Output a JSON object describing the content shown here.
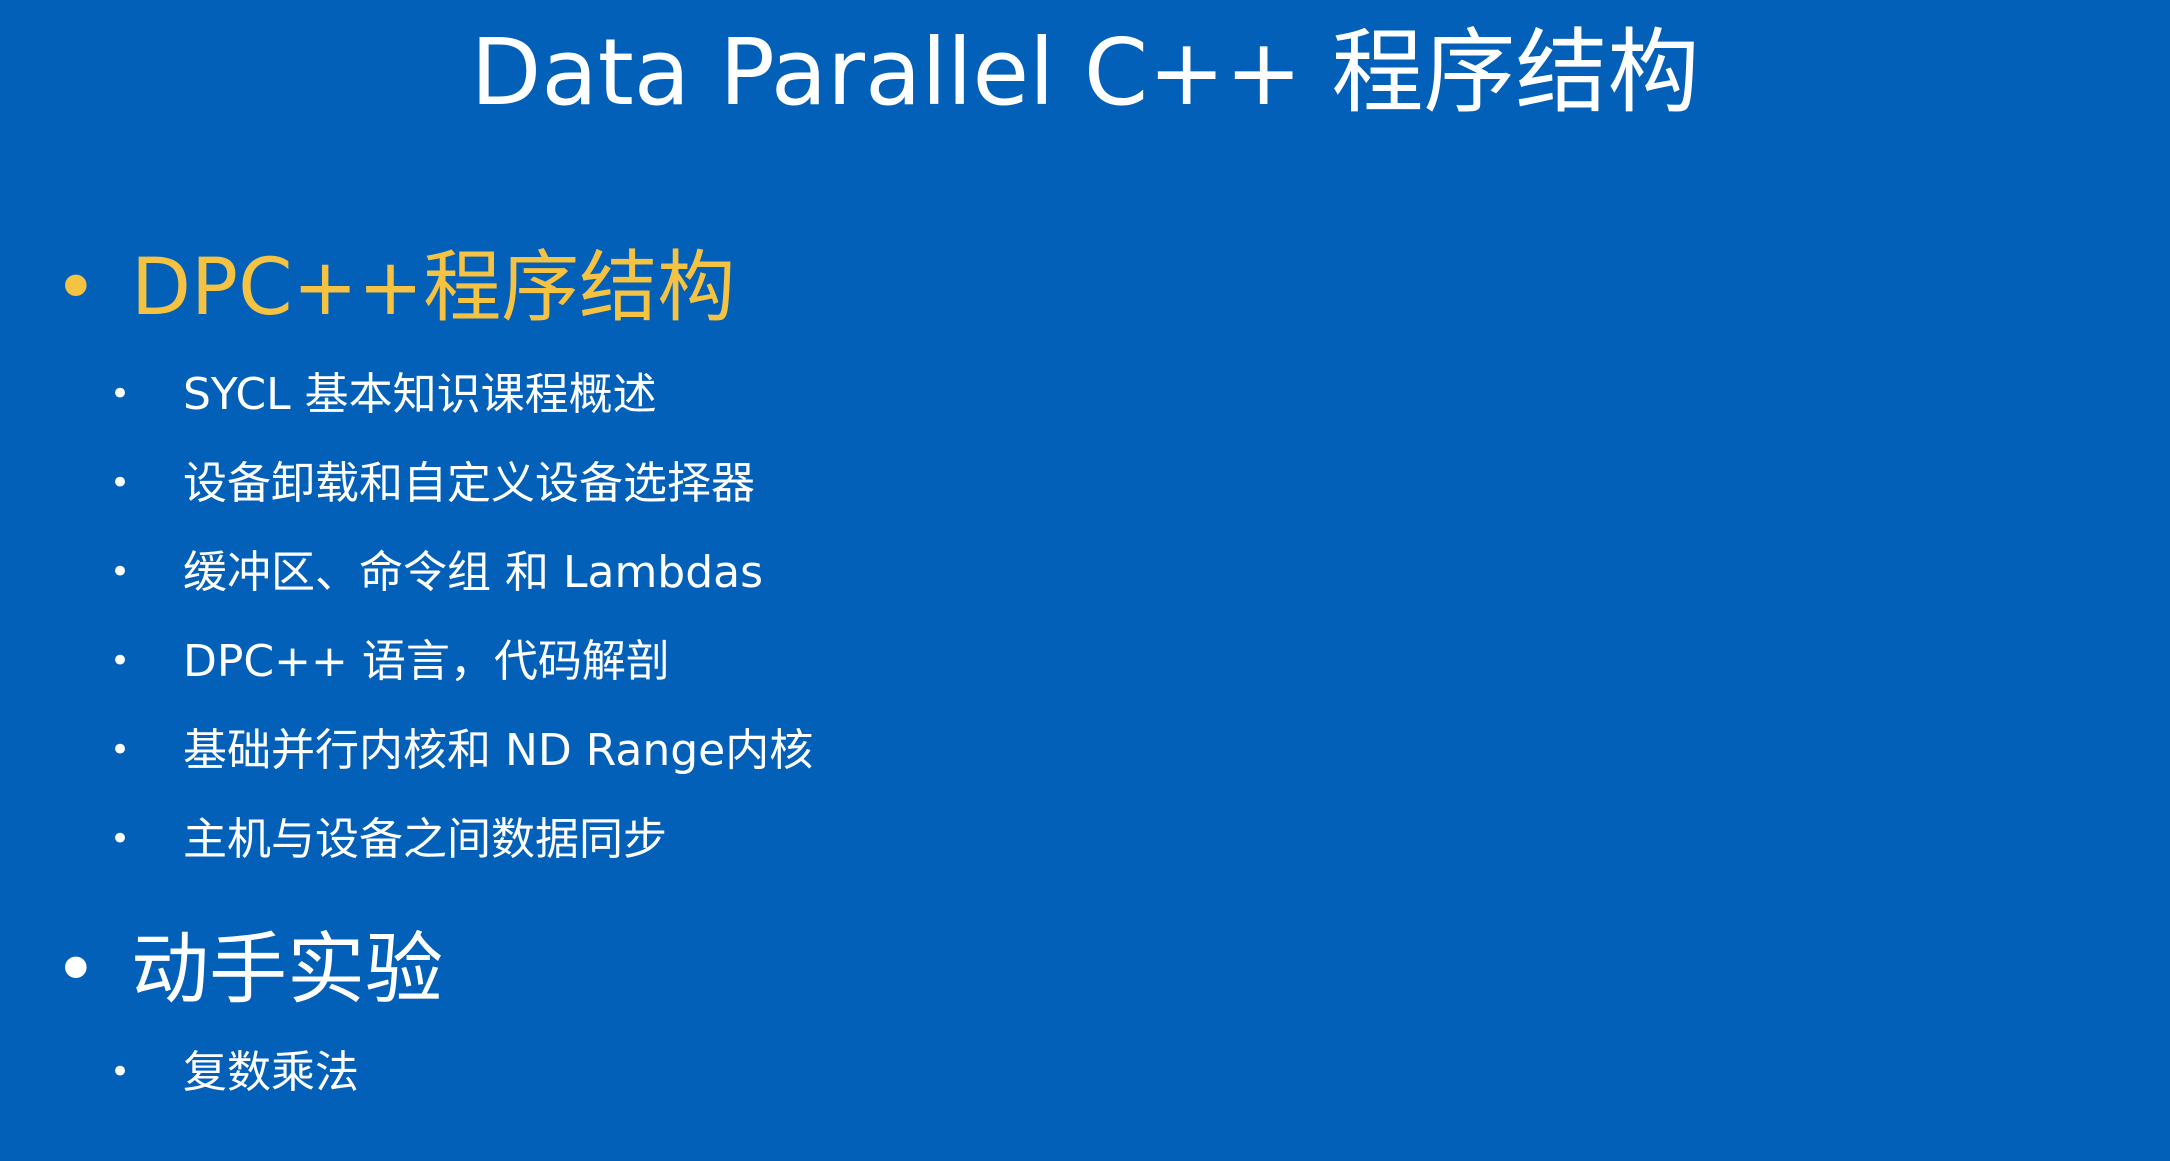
{
  "slide": {
    "title": "Data Parallel C++ 程序结构",
    "colors": {
      "background": "#0360b8",
      "accent": "#f5c242",
      "text": "#ffffff"
    },
    "sections": [
      {
        "heading": "DPC++程序结构",
        "highlighted": true,
        "items": [
          "SYCL 基本知识课程概述",
          "设备卸载和自定义设备选择器",
          "缓冲区、命令组 和 Lambdas",
          "DPC++ 语言，代码解剖",
          "基础并行内核和 ND Range内核",
          "主机与设备之间数据同步"
        ]
      },
      {
        "heading": "动手实验",
        "highlighted": false,
        "items": [
          "复数乘法"
        ]
      }
    ]
  }
}
